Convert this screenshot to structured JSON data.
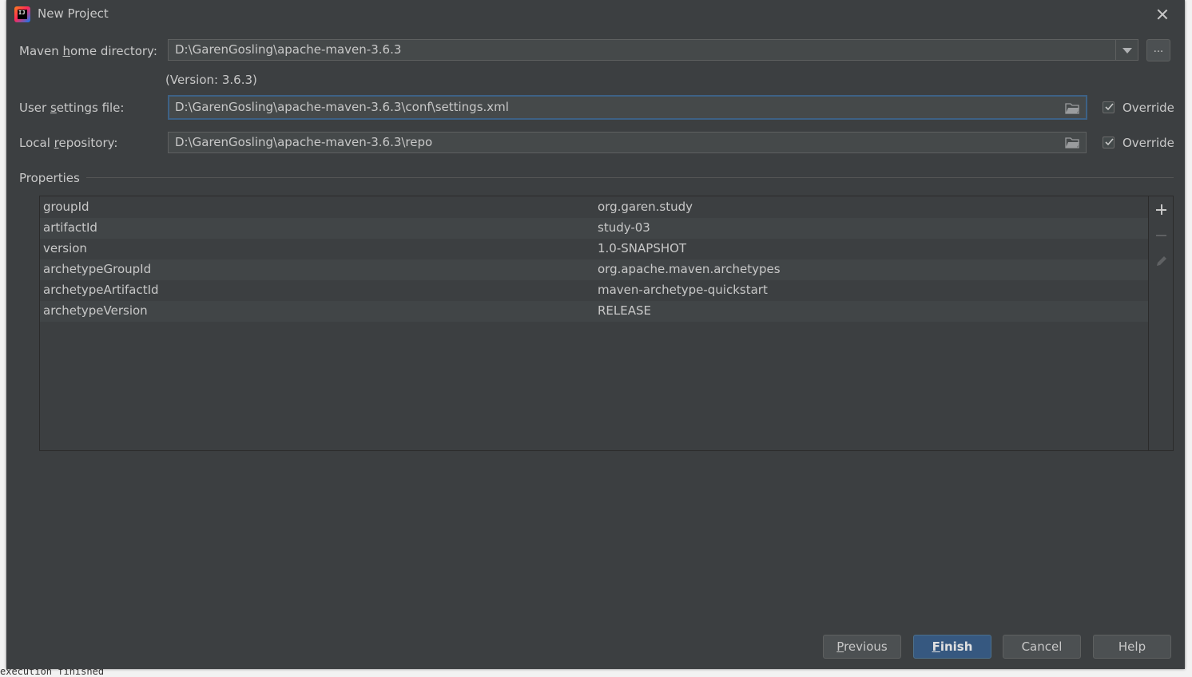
{
  "window": {
    "title": "New Project",
    "close_label": "close"
  },
  "maven": {
    "home_label_pre": "Maven ",
    "home_label_mn": "h",
    "home_label_post": "ome directory:",
    "home_value": "D:\\GarenGosling\\apache-maven-3.6.3",
    "browse_label": "...",
    "version_text": "(Version: 3.6.3)",
    "settings_label_pre": "User ",
    "settings_label_mn": "s",
    "settings_label_post": "ettings file:",
    "settings_value": "D:\\GarenGosling\\apache-maven-3.6.3\\conf\\settings.xml",
    "settings_override": "Override",
    "settings_override_checked": true,
    "repo_label_pre": "Local ",
    "repo_label_mn": "r",
    "repo_label_post": "epository:",
    "repo_value": "D:\\GarenGosling\\apache-maven-3.6.3\\repo",
    "repo_override": "Override",
    "repo_override_checked": true
  },
  "properties": {
    "title": "Properties",
    "rows": [
      {
        "key": "groupId",
        "value": "org.garen.study"
      },
      {
        "key": "artifactId",
        "value": "study-03"
      },
      {
        "key": "version",
        "value": "1.0-SNAPSHOT"
      },
      {
        "key": "archetypeGroupId",
        "value": "org.apache.maven.archetypes"
      },
      {
        "key": "archetypeArtifactId",
        "value": "maven-archetype-quickstart"
      },
      {
        "key": "archetypeVersion",
        "value": "RELEASE"
      }
    ]
  },
  "buttons": {
    "previous_mn": "P",
    "previous_rest": "revious",
    "finish_mn": "F",
    "finish_rest": "inish",
    "cancel": "Cancel",
    "help": "Help"
  },
  "background": {
    "bottom_text": "execution finished"
  },
  "icons": {
    "app": "intellij-idea-icon",
    "close": "close-icon",
    "combo": "chevron-down-icon",
    "folder": "folder-icon",
    "checkbox": "check-icon",
    "add": "plus-icon",
    "remove": "minus-icon",
    "edit": "pencil-icon"
  },
  "colors": {
    "dialog_bg": "#3c3f41",
    "field_bg": "#45494a",
    "focus_border": "#3d6185",
    "primary_button": "#365880",
    "text": "#c8c8c8"
  }
}
